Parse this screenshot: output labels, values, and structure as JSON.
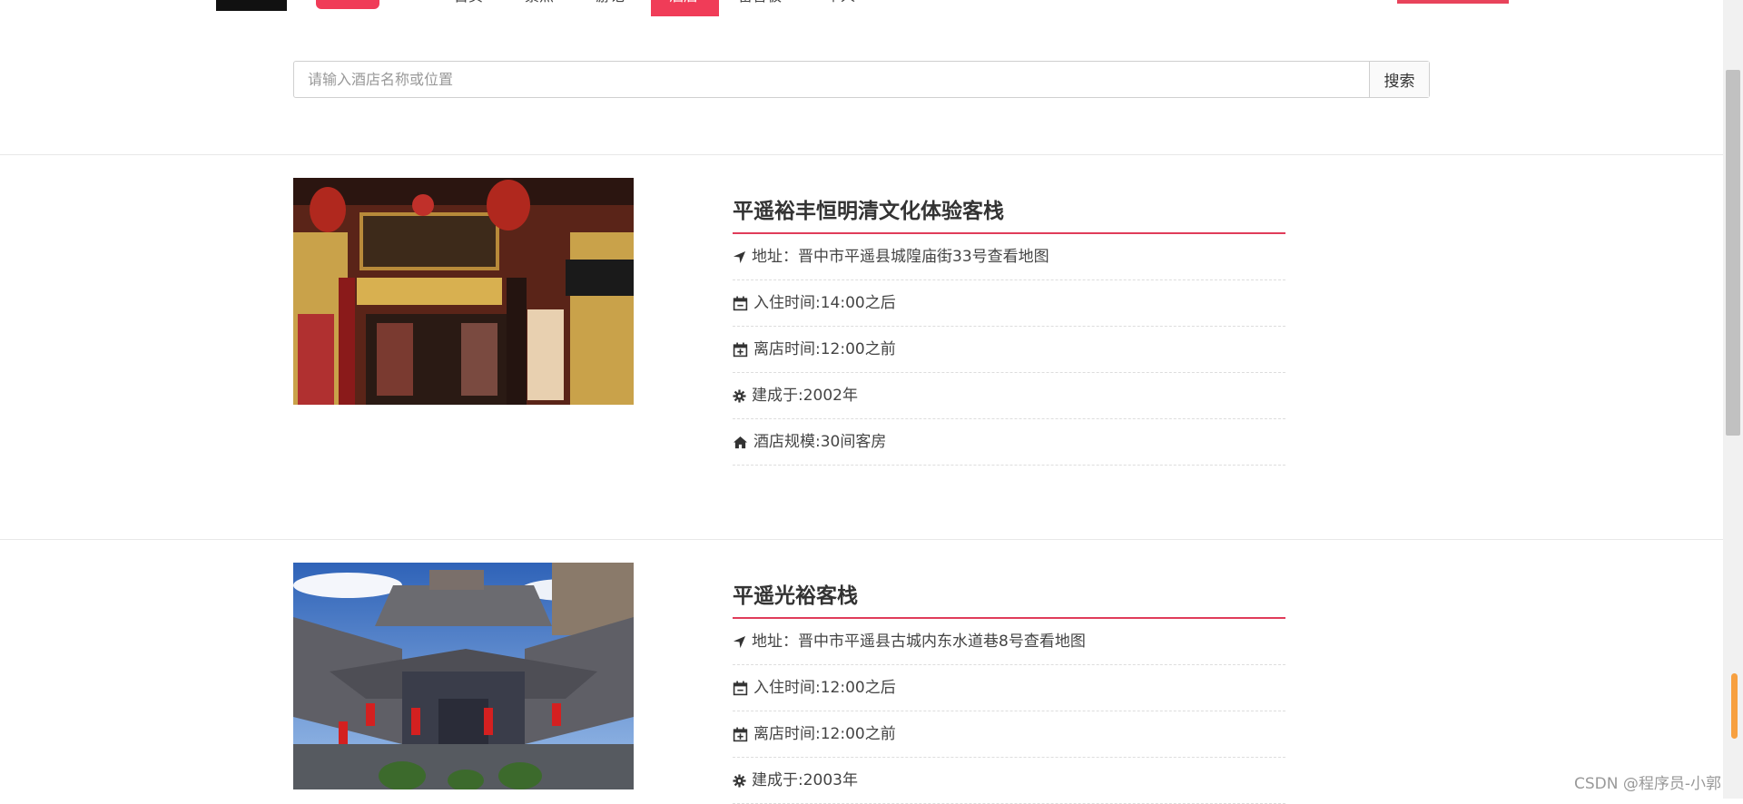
{
  "header": {
    "nav": [
      "首页",
      "景点",
      "游记",
      "酒店",
      "留言板",
      "个人"
    ],
    "active_index": 3
  },
  "search": {
    "placeholder": "请输入酒店名称或位置",
    "button_label": "搜索"
  },
  "hotels": [
    {
      "name": "平遥裕丰恒明清文化体验客栈",
      "address": "地址：晋中市平遥县城隍庙街33号查看地图",
      "checkin": "入住时间:14:00之后",
      "checkout": "离店时间:12:00之前",
      "built": "建成于:2002年",
      "scale": "酒店规模:30间客房"
    },
    {
      "name": "平遥光裕客栈",
      "address": "地址：晋中市平遥县古城内东水道巷8号查看地图",
      "checkin": "入住时间:12:00之后",
      "checkout": "离店时间:12:00之前",
      "built": "建成于:2003年"
    }
  ],
  "watermark": "CSDN @程序员-小郭",
  "colors": {
    "accent": "#e03c5a"
  }
}
